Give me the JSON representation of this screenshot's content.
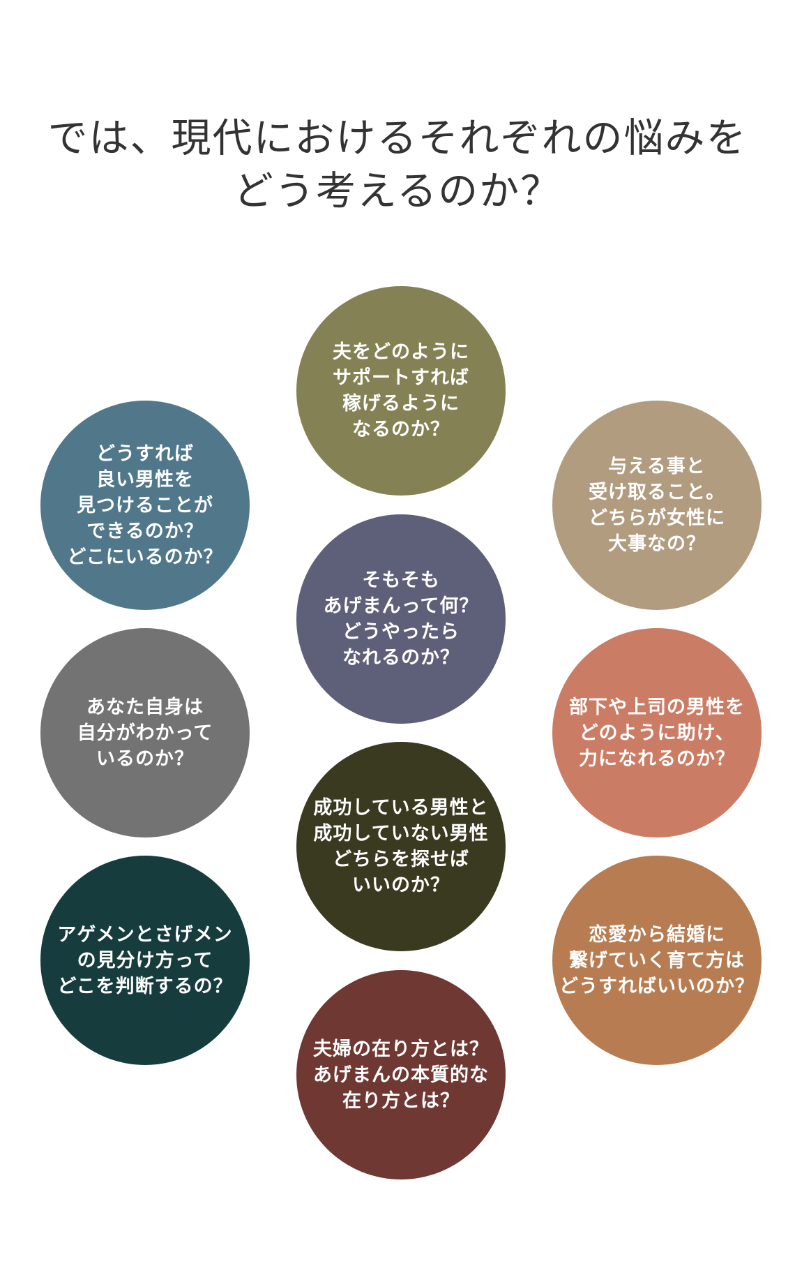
{
  "heading": {
    "line1": "では、現代におけるそれぞれの悩みを",
    "line2": "どう考えるのか？"
  },
  "circles": [
    {
      "color": "#848254",
      "lines": [
        "夫をどのように",
        "サポートすれば",
        "稼げるように",
        "なるのか？"
      ]
    },
    {
      "color": "#50788a",
      "lines": [
        "どうすれば",
        "良い男性を",
        "見つけることが",
        "できるのか？",
        "どこにいるのか？"
      ]
    },
    {
      "color": "#b19c80",
      "lines": [
        "与える事と",
        "受け取ること。",
        "どちらが女性に",
        "大事なの？"
      ]
    },
    {
      "color": "#5e6079",
      "lines": [
        "そもそも",
        "あげまんって何？",
        "どうやったら",
        "なれるのか？"
      ]
    },
    {
      "color": "#737373",
      "lines": [
        "あなた自身は",
        "自分がわかって",
        "いるのか？"
      ]
    },
    {
      "color": "#cb7c64",
      "lines": [
        "部下や上司の男性を",
        "どのように助け、",
        "力になれるのか？"
      ]
    },
    {
      "color": "#3a3a21",
      "lines": [
        "成功している男性と",
        "成功していない男性",
        "どちらを探せば",
        "いいのか？"
      ]
    },
    {
      "color": "#173c3e",
      "lines": [
        "アゲメンとさげメン",
        "の見分け方って",
        "どこを判断するの？"
      ]
    },
    {
      "color": "#b77c51",
      "lines": [
        "恋愛から結婚に",
        "繋げていく育て方は",
        "どうすればいいのか？"
      ]
    },
    {
      "color": "#6f3832",
      "lines": [
        "夫婦の在り方とは？",
        "あげまんの本質的な",
        "在り方とは？"
      ]
    }
  ]
}
